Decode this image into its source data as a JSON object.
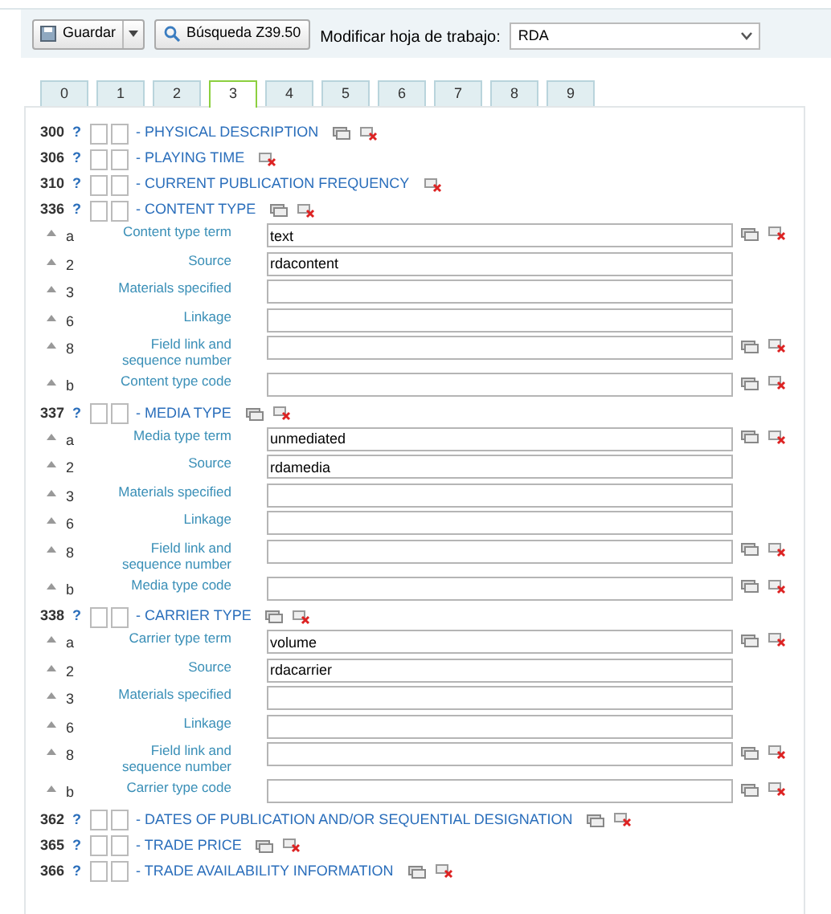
{
  "toolbar": {
    "save_button": "Guardar",
    "search_button": "Búsqueda Z39.50",
    "worksheet_label": "Modificar hoja de trabajo:",
    "worksheet_value": "RDA"
  },
  "tabs": [
    {
      "label": "0",
      "selected": false
    },
    {
      "label": "1",
      "selected": false
    },
    {
      "label": "2",
      "selected": false
    },
    {
      "label": "3",
      "selected": true
    },
    {
      "label": "4",
      "selected": false
    },
    {
      "label": "5",
      "selected": false
    },
    {
      "label": "6",
      "selected": false
    },
    {
      "label": "7",
      "selected": false
    },
    {
      "label": "8",
      "selected": false
    },
    {
      "label": "9",
      "selected": false
    }
  ],
  "fields": [
    {
      "tag": "300",
      "help": "?",
      "title": "- PHYSICAL DESCRIPTION",
      "repeat_icon": true,
      "delete_icon": true
    },
    {
      "tag": "306",
      "help": "?",
      "title": "- PLAYING TIME",
      "repeat_icon": false,
      "delete_icon": true
    },
    {
      "tag": "310",
      "help": "?",
      "title": "- CURRENT PUBLICATION FREQUENCY",
      "repeat_icon": false,
      "delete_icon": true
    },
    {
      "tag": "336",
      "help": "?",
      "title": "- CONTENT TYPE",
      "repeat_icon": true,
      "delete_icon": true,
      "subfields": [
        {
          "code": "a",
          "label": "Content type term",
          "value": "text",
          "repeat_icon": true,
          "delete_icon": true
        },
        {
          "code": "2",
          "label": "Source",
          "value": "rdacontent",
          "repeat_icon": false,
          "delete_icon": false
        },
        {
          "code": "3",
          "label": "Materials specified",
          "repeat_icon": false,
          "delete_icon": false
        },
        {
          "code": "6",
          "label": "Linkage",
          "repeat_icon": false,
          "delete_icon": false
        },
        {
          "code": "8",
          "label": "Field link and sequence number",
          "repeat_icon": true,
          "delete_icon": true
        },
        {
          "code": "b",
          "label": "Content type code",
          "repeat_icon": true,
          "delete_icon": true
        }
      ]
    },
    {
      "tag": "337",
      "help": "?",
      "title": "- MEDIA TYPE",
      "repeat_icon": true,
      "delete_icon": true,
      "subfields": [
        {
          "code": "a",
          "label": "Media type term",
          "value": "unmediated",
          "repeat_icon": true,
          "delete_icon": true
        },
        {
          "code": "2",
          "label": "Source",
          "value": "rdamedia",
          "repeat_icon": false,
          "delete_icon": false
        },
        {
          "code": "3",
          "label": "Materials specified",
          "repeat_icon": false,
          "delete_icon": false
        },
        {
          "code": "6",
          "label": "Linkage",
          "repeat_icon": false,
          "delete_icon": false
        },
        {
          "code": "8",
          "label": "Field link and sequence number",
          "repeat_icon": true,
          "delete_icon": true
        },
        {
          "code": "b",
          "label": "Media type code",
          "repeat_icon": true,
          "delete_icon": true
        }
      ]
    },
    {
      "tag": "338",
      "help": "?",
      "title": "- CARRIER TYPE",
      "repeat_icon": true,
      "delete_icon": true,
      "subfields": [
        {
          "code": "a",
          "label": "Carrier type term",
          "value": "volume",
          "repeat_icon": true,
          "delete_icon": true
        },
        {
          "code": "2",
          "label": "Source",
          "value": "rdacarrier",
          "repeat_icon": false,
          "delete_icon": false
        },
        {
          "code": "3",
          "label": "Materials specified",
          "repeat_icon": false,
          "delete_icon": false
        },
        {
          "code": "6",
          "label": "Linkage",
          "repeat_icon": false,
          "delete_icon": false
        },
        {
          "code": "8",
          "label": "Field link and sequence number",
          "repeat_icon": true,
          "delete_icon": true
        },
        {
          "code": "b",
          "label": "Carrier type code",
          "repeat_icon": true,
          "delete_icon": true
        }
      ]
    },
    {
      "tag": "362",
      "help": "?",
      "title": "- DATES OF PUBLICATION AND/OR SEQUENTIAL DESIGNATION",
      "repeat_icon": true,
      "delete_icon": true
    },
    {
      "tag": "365",
      "help": "?",
      "title": "- TRADE PRICE",
      "repeat_icon": true,
      "delete_icon": true
    },
    {
      "tag": "366",
      "help": "?",
      "title": "- TRADE AVAILABILITY INFORMATION",
      "repeat_icon": true,
      "delete_icon": true
    }
  ]
}
